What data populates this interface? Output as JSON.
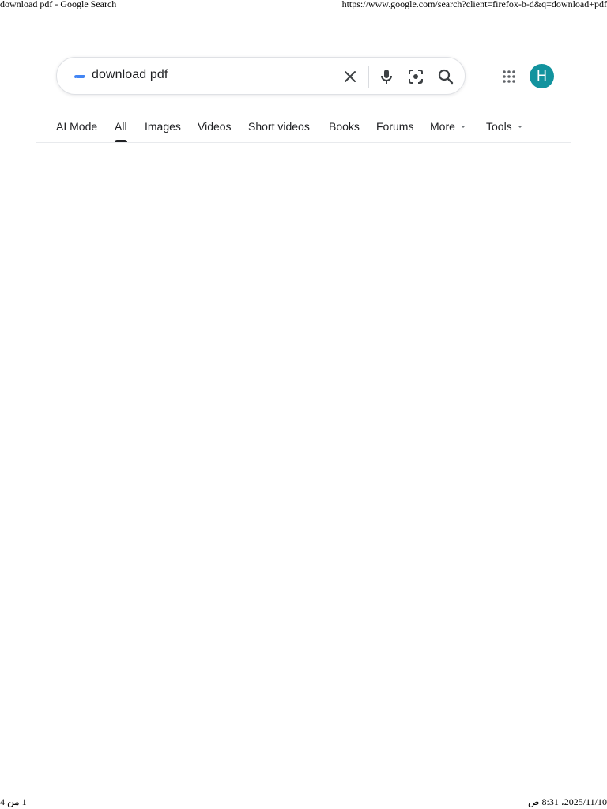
{
  "print_header": {
    "page_title": "download pdf - Google Search",
    "url": "https://www.google.com/search?client=firefox-b-d&q=download+pdf"
  },
  "search": {
    "query": "download pdf"
  },
  "account": {
    "avatar_letter": "H",
    "avatar_color": "#12939e"
  },
  "tabs": [
    {
      "label": "AI Mode"
    },
    {
      "label": "All",
      "active": true
    },
    {
      "label": "Images"
    },
    {
      "label": "Videos"
    },
    {
      "label": "Short videos"
    },
    {
      "label": "Books"
    },
    {
      "label": "Forums"
    },
    {
      "label": "More",
      "has_dropdown": true
    },
    {
      "label": "Tools",
      "has_dropdown": true
    }
  ],
  "print_footer": {
    "page_counter": "1 من 4",
    "datetime": "2025/11/10، 8:31 ص"
  },
  "icons": {
    "clear": "close-icon",
    "voice": "mic-icon",
    "image_search": "lens-icon",
    "submit": "search-icon",
    "apps": "apps-grid-icon"
  },
  "colors": {
    "google_blue": "#4285f4",
    "text": "#202124",
    "icon_gray": "#5f6368"
  }
}
